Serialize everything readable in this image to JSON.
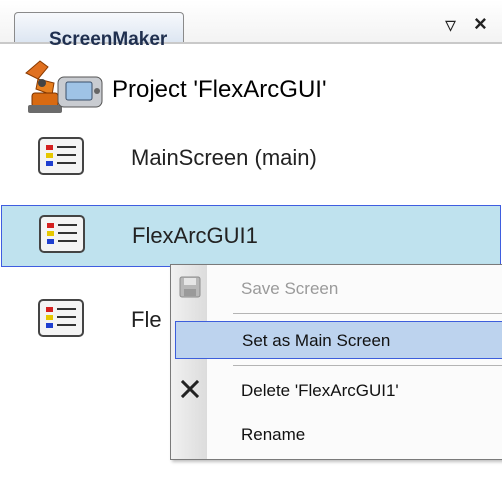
{
  "panel": {
    "tab_label": "ScreenMaker",
    "pin_glyph": "▿",
    "close_glyph": "×"
  },
  "project": {
    "label": "Project 'FlexArcGUI'",
    "icon": "robot-icon"
  },
  "screens": [
    {
      "label": "MainScreen (main)",
      "icon": "screen-list-icon",
      "selected": false
    },
    {
      "label": "FlexArcGUI1",
      "icon": "screen-list-icon",
      "selected": true
    },
    {
      "label": "Fle",
      "icon": "screen-list-icon",
      "selected": false
    }
  ],
  "context_menu": {
    "items": [
      {
        "label": "Save Screen",
        "icon": "save-icon",
        "enabled": false
      },
      {
        "label": "Set as Main Screen",
        "icon": "",
        "enabled": true,
        "highlighted": true
      },
      {
        "label": "Delete 'FlexArcGUI1'",
        "icon": "delete-x-icon",
        "enabled": true
      },
      {
        "label": "Rename",
        "icon": "",
        "enabled": true
      }
    ]
  },
  "colors": {
    "selection_fill": "#bfe2ee",
    "selection_border": "#3f5de0",
    "menu_highlight": "#bdd3ee"
  }
}
